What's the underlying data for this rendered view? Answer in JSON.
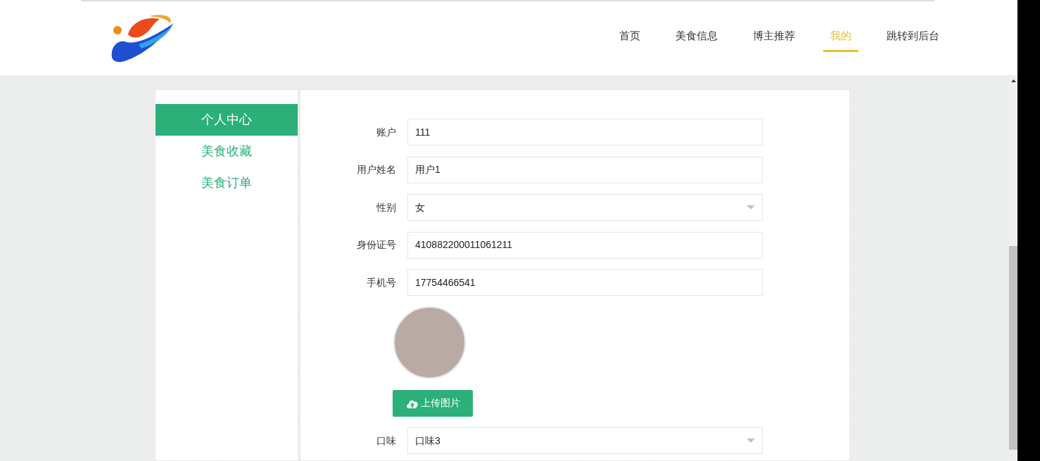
{
  "nav": {
    "items": [
      {
        "label": "首页",
        "selected": false
      },
      {
        "label": "美食信息",
        "selected": false
      },
      {
        "label": "博主推荐",
        "selected": false
      },
      {
        "label": "我的",
        "selected": true
      },
      {
        "label": "跳转到后台",
        "selected": false
      }
    ]
  },
  "sidebar": {
    "items": [
      {
        "label": "个人中心",
        "selected": true
      },
      {
        "label": "美食收藏",
        "selected": false
      },
      {
        "label": "美食订单",
        "selected": false
      }
    ]
  },
  "form": {
    "fields": [
      {
        "kind": "text",
        "label": "账户",
        "value": "111"
      },
      {
        "kind": "text",
        "label": "用户姓名",
        "value": "用户1"
      },
      {
        "kind": "select",
        "label": "性别",
        "value": "女"
      },
      {
        "kind": "text",
        "label": "身份证号",
        "value": "410882200011061211"
      },
      {
        "kind": "text",
        "label": "手机号",
        "value": "17754466541"
      },
      {
        "kind": "avatar",
        "button": "上传图片"
      },
      {
        "kind": "select",
        "label": "口味",
        "value": "口味3"
      }
    ]
  }
}
